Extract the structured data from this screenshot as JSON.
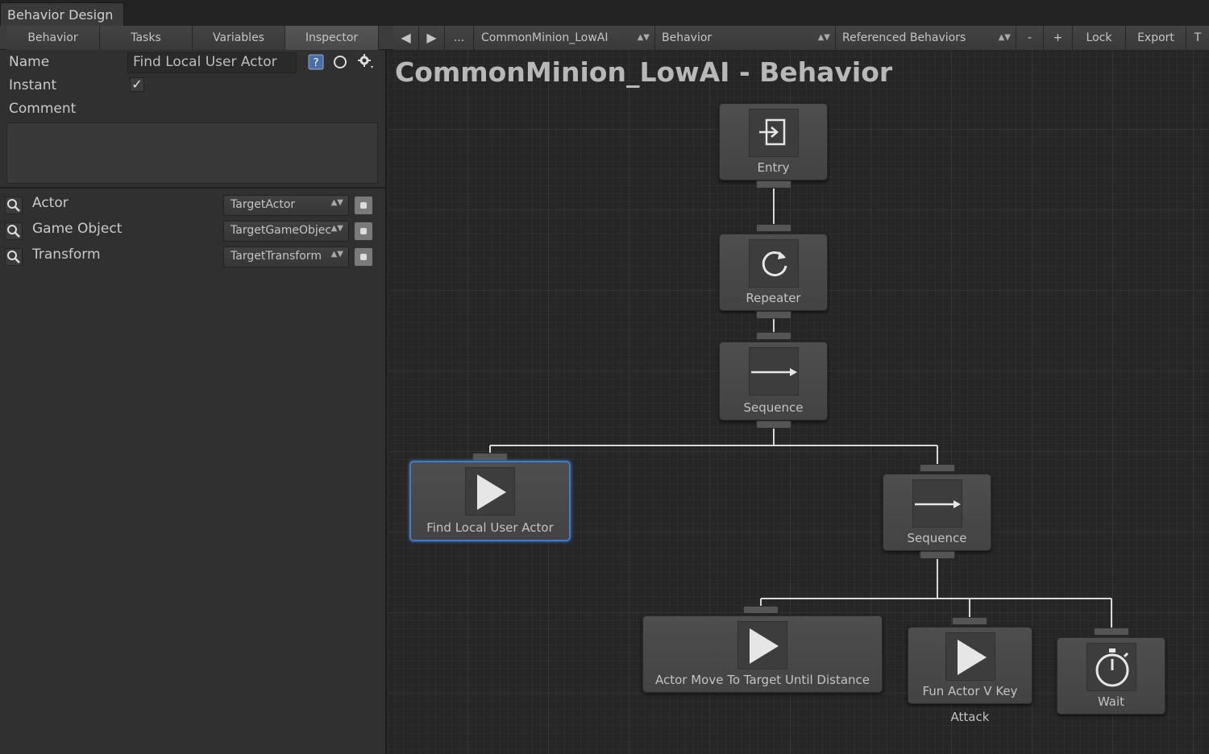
{
  "window": {
    "tab_title": "Behavior Design"
  },
  "toolbar": {
    "tabs": [
      "Behavior",
      "Tasks",
      "Variables",
      "Inspector"
    ],
    "back_glyph": "◀",
    "forward_glyph": "▶",
    "more_label": "...",
    "behavior_select": "CommonMinion_LowAI",
    "type_select": "Behavior",
    "referenced_select": "Referenced Behaviors",
    "minus_label": "-",
    "plus_label": "+",
    "lock_label": "Lock",
    "export_label": "Export",
    "overflow_label": "T"
  },
  "inspector": {
    "name_label": "Name",
    "name_value": "Find Local User Actor",
    "instant_label": "Instant",
    "instant_checked": true,
    "comment_label": "Comment",
    "comment_value": "",
    "variables": [
      {
        "label": "Actor",
        "value": "TargetActor"
      },
      {
        "label": "Game Object",
        "value": "TargetGameObjec"
      },
      {
        "label": "Transform",
        "value": "TargetTransform"
      }
    ]
  },
  "canvas": {
    "title": "CommonMinion_LowAI - Behavior",
    "nodes": {
      "entry": "Entry",
      "repeater": "Repeater",
      "sequence1": "Sequence",
      "find_actor": "Find Local User Actor",
      "sequence2": "Sequence",
      "move_to": "Actor Move To Target Until Distance",
      "fun_actor": "Fun Actor V Key",
      "fun_actor_comment": "Attack",
      "wait": "Wait"
    }
  },
  "colors": {
    "selection": "#3e7cc9",
    "background": "#262626",
    "panel": "#303030"
  }
}
